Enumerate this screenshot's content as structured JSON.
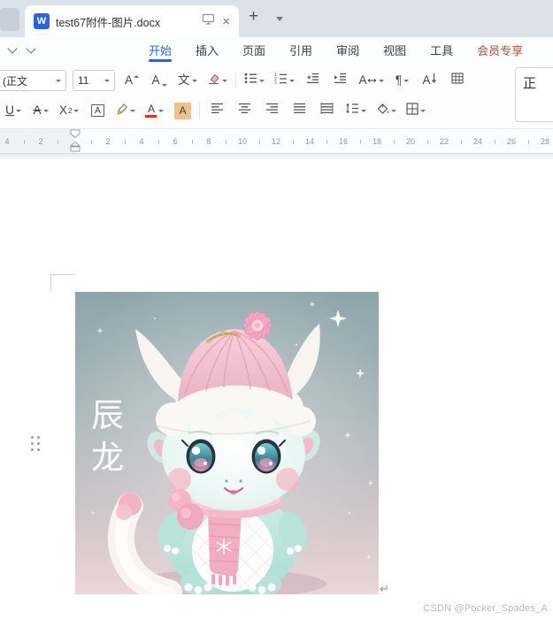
{
  "tab_bar": {
    "doc_tab": {
      "icon_letter": "W",
      "title": "test67附件-图片.docx",
      "close_label": "×"
    },
    "new_tab_label": "+"
  },
  "menu_bar": {
    "items": [
      {
        "label": "开始",
        "active": true
      },
      {
        "label": "插入"
      },
      {
        "label": "页面"
      },
      {
        "label": "引用"
      },
      {
        "label": "审阅"
      },
      {
        "label": "视图"
      },
      {
        "label": "工具"
      },
      {
        "label": "会员专享",
        "accent": true
      }
    ]
  },
  "toolbar": {
    "font_name": "a (正文",
    "font_size": "11",
    "increase_font_label": "A",
    "decrease_font_label": "A",
    "text_tool_label": "文",
    "paragraph_glyph": "¶",
    "underline_label": "U",
    "strikethrough_label": "A",
    "superscript_base": "X",
    "superscript_exp": "2",
    "char_border_label": "A",
    "font_color_label": "A",
    "char_shading_label": "A",
    "char_scale_label": "A",
    "sort_label": "A"
  },
  "style_gallery": {
    "visible_style": "正"
  },
  "ruler": {
    "left_numbers": [
      "4",
      "2"
    ],
    "right_numbers": [
      "2",
      "4",
      "6",
      "8",
      "10",
      "12",
      "14",
      "16",
      "18",
      "20",
      "22",
      "24",
      "26",
      "28"
    ]
  },
  "document": {
    "image_caption_chars": [
      "辰",
      "龙"
    ],
    "paragraph_mark": "↵"
  },
  "watermark": "CSDN @Pocker_Spades_A",
  "colors": {
    "accent_blue": "#2466e0",
    "member_red": "#b8503a",
    "font_color_red": "#e0341f",
    "doc_icon_blue": "#2b66d9",
    "tabbar_bg": "#dce2ea"
  }
}
